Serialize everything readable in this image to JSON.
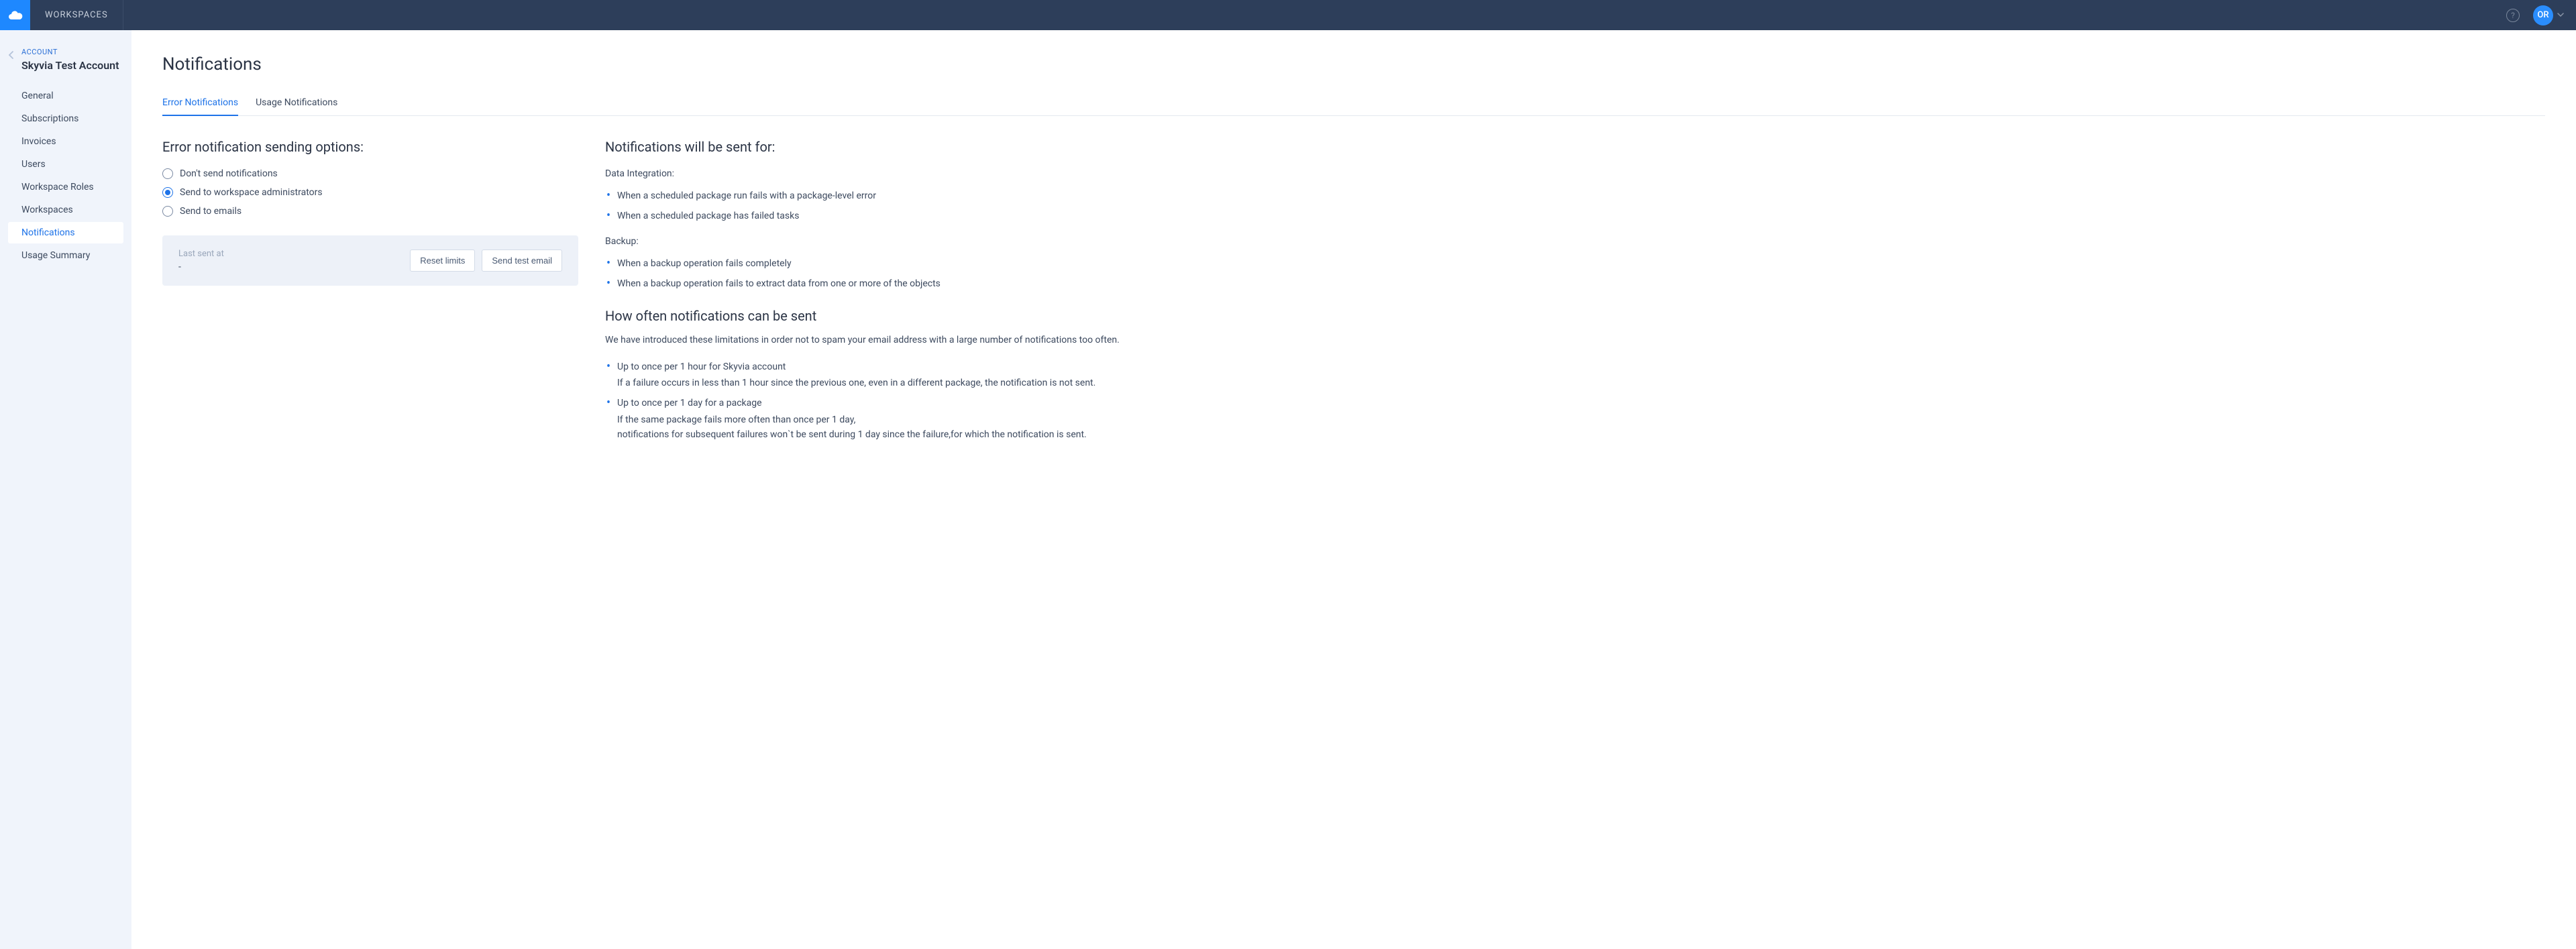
{
  "topbar": {
    "workspaces_label": "WORKSPACES",
    "avatar_initials": "OR"
  },
  "sidebar": {
    "eyebrow": "ACCOUNT",
    "title": "Skyvia Test Account",
    "items": [
      {
        "label": "General"
      },
      {
        "label": "Subscriptions"
      },
      {
        "label": "Invoices"
      },
      {
        "label": "Users"
      },
      {
        "label": "Workspace Roles"
      },
      {
        "label": "Workspaces"
      },
      {
        "label": "Notifications"
      },
      {
        "label": "Usage Summary"
      }
    ],
    "active_index": 6
  },
  "page": {
    "title": "Notifications",
    "tabs": [
      {
        "label": "Error Notifications"
      },
      {
        "label": "Usage Notifications"
      }
    ],
    "active_tab": 0,
    "left": {
      "heading": "Error notification sending options:",
      "options": [
        {
          "label": "Don't send notifications"
        },
        {
          "label": "Send to workspace administrators"
        },
        {
          "label": "Send to emails"
        }
      ],
      "selected_option": 1,
      "panel": {
        "last_sent_label": "Last sent at",
        "last_sent_value": "-",
        "reset_label": "Reset limits",
        "send_test_label": "Send test email"
      }
    },
    "right": {
      "heading_sent_for": "Notifications will be sent for:",
      "di_label": "Data Integration:",
      "di_items": [
        "When a scheduled package run fails with a package-level error",
        "When a scheduled package has failed tasks"
      ],
      "backup_label": "Backup:",
      "backup_items": [
        "When a backup operation fails completely",
        "When a backup operation fails to extract data from one or more of the objects"
      ],
      "heading_freq": "How often notifications can be sent",
      "freq_intro": "We have introduced these limitations in order not to spam your email address with a large number of notifications too often.",
      "freq_items": [
        {
          "title": "Up to once per 1 hour for Skyvia account",
          "sub": "If a failure occurs in less than 1 hour since the previous one, even in a different package, the notification is not sent."
        },
        {
          "title": "Up to once per 1 day for a package",
          "sub": "If the same package fails more often than once per 1 day,\nnotifications for subsequent failures won`t be sent during 1 day since the failure,for which the notification is sent."
        }
      ]
    }
  }
}
